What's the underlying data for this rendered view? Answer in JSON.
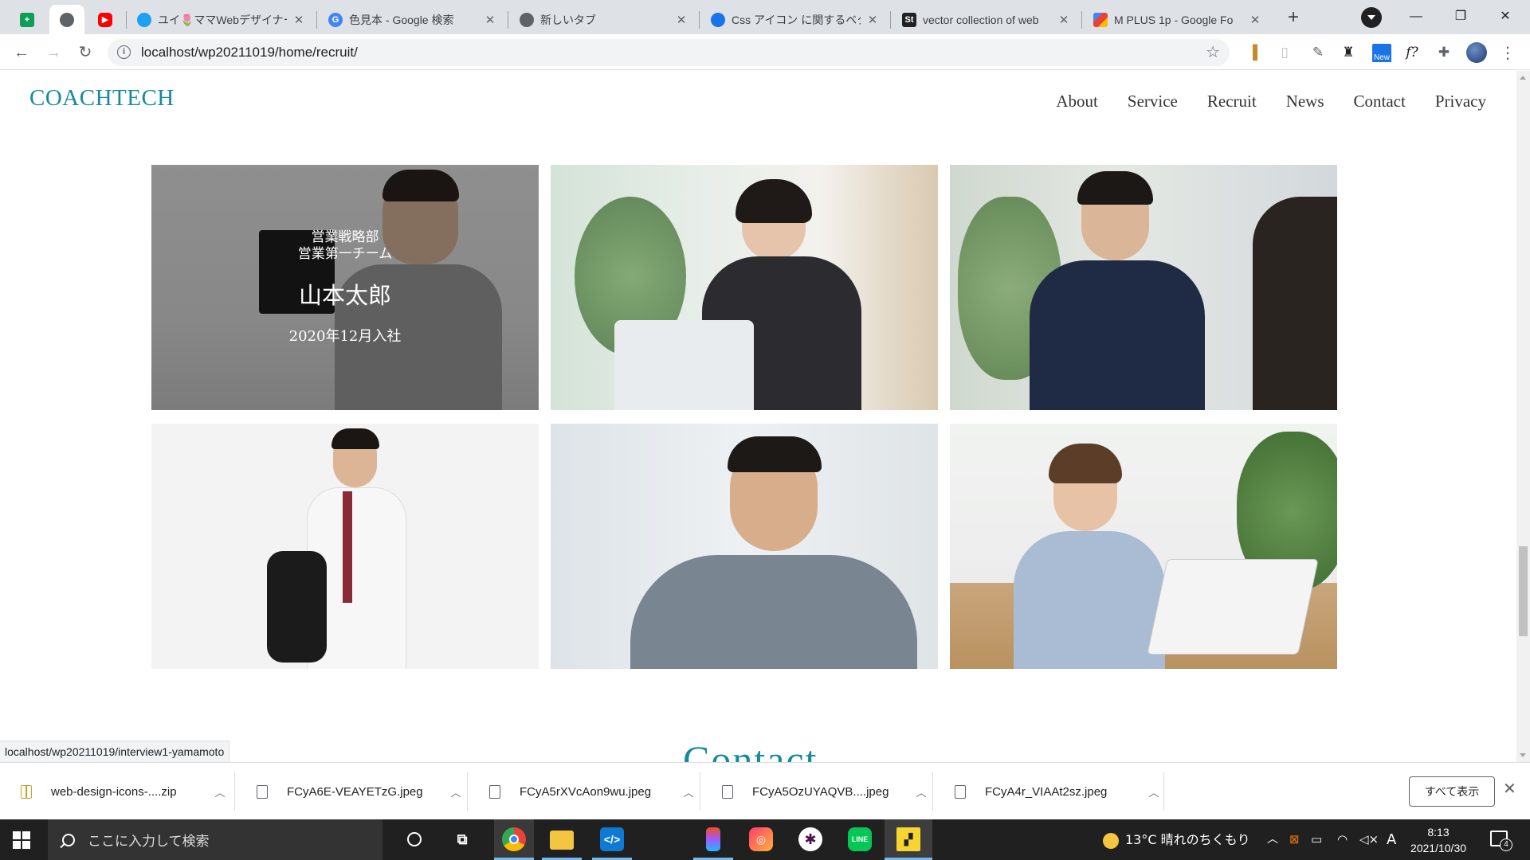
{
  "browser": {
    "tabs": [
      {
        "title": "",
        "favicon": "google-sheets-icon",
        "color": "#0f9d58"
      },
      {
        "title": "",
        "favicon": "globe-icon",
        "color": "#5f6368",
        "active": true
      },
      {
        "title": "",
        "favicon": "youtube-icon",
        "color": "#ff0000"
      },
      {
        "title": "ユイ🌷ママWebデザイナー/",
        "favicon": "twitter-icon",
        "color": "#1da1f2"
      },
      {
        "title": "色見本 - Google 検索",
        "favicon": "google-icon",
        "color": "#4285f4"
      },
      {
        "title": "新しいタブ",
        "favicon": "chrome-icon",
        "color": "#5f6368"
      },
      {
        "title": "Css アイコン に関するベクタ",
        "favicon": "vector-site-icon",
        "color": "#1a73e8"
      },
      {
        "title": "vector collection of web",
        "favicon": "shutterstock-icon",
        "color": "#202124"
      },
      {
        "title": "M PLUS 1p - Google Fo",
        "favicon": "google-fonts-icon",
        "color": "#ea4335"
      }
    ],
    "url": "localhost/wp20211019/home/recruit/",
    "new_badge": "New",
    "ext_fx": "f?"
  },
  "site": {
    "logo": "COACHTECH",
    "nav": [
      "About",
      "Service",
      "Recruit",
      "News",
      "Contact",
      "Privacy"
    ],
    "featured_interview": {
      "dept_line1": "営業戦略部",
      "dept_line2": "営業第一チーム",
      "name": "山本太郎",
      "joined": "2020年12月入社"
    },
    "next_section_title": "Contact",
    "status_url": "localhost/wp20211019/interview1-yamamoto"
  },
  "downloads": {
    "items": [
      "web-design-icons-....zip",
      "FCyA6E-VEAYETzG.jpeg",
      "FCyA5rXVcAon9wu.jpeg",
      "FCyA5OzUYAQVB....jpeg",
      "FCyA4r_VIAAt2sz.jpeg"
    ],
    "show_all": "すべて表示"
  },
  "taskbar": {
    "search_placeholder": "ここに入力して検索",
    "weather": "13°C  晴れのちくもり",
    "time": "8:13",
    "date": "2021/10/30",
    "notifications": "4",
    "ime": "A"
  }
}
